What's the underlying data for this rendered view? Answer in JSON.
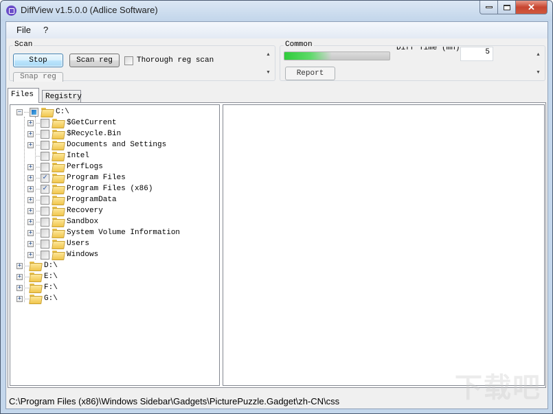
{
  "window": {
    "title": "DiffView v1.5.0.0 (Adlice Software)",
    "controls": {
      "minimize": "minimize",
      "maximize": "maximize",
      "close": "✕"
    }
  },
  "menu": {
    "items": [
      {
        "label": "File"
      },
      {
        "label": "?"
      }
    ]
  },
  "scan": {
    "group_label": "Scan",
    "stop_label": "Stop",
    "scan_reg_label": "Scan reg",
    "thorough_label": "Thorough reg scan",
    "thorough_checked": false,
    "snap_reg_label": "Snap reg"
  },
  "common": {
    "group_label": "Common",
    "progress_percent": 45,
    "diff_time_label": "Diff Time (mn)",
    "diff_time_value": "5",
    "report_label": "Report"
  },
  "tabs": [
    {
      "label": "Files",
      "active": true
    },
    {
      "label": "Registry",
      "active": false
    }
  ],
  "tree": {
    "root": {
      "label": "C:\\",
      "state": "partial",
      "expanded": true
    },
    "children": [
      {
        "label": "$GetCurrent",
        "checked": false,
        "expandable": true
      },
      {
        "label": "$Recycle.Bin",
        "checked": false,
        "expandable": true
      },
      {
        "label": "Documents and Settings",
        "checked": false,
        "expandable": true
      },
      {
        "label": "Intel",
        "checked": false,
        "expandable": false
      },
      {
        "label": "PerfLogs",
        "checked": false,
        "expandable": true
      },
      {
        "label": "Program Files",
        "checked": true,
        "expandable": true
      },
      {
        "label": "Program Files (x86)",
        "checked": true,
        "expandable": true
      },
      {
        "label": "ProgramData",
        "checked": false,
        "expandable": true
      },
      {
        "label": "Recovery",
        "checked": false,
        "expandable": true
      },
      {
        "label": "Sandbox",
        "checked": false,
        "expandable": true
      },
      {
        "label": "System Volume Information",
        "checked": false,
        "expandable": true
      },
      {
        "label": "Users",
        "checked": false,
        "expandable": true
      },
      {
        "label": "Windows",
        "checked": false,
        "expandable": true
      }
    ],
    "drives": [
      {
        "label": "D:\\"
      },
      {
        "label": "E:\\"
      },
      {
        "label": "F:\\"
      },
      {
        "label": "G:\\"
      }
    ]
  },
  "status": {
    "path": "C:\\Program Files (x86)\\Windows Sidebar\\Gadgets\\PicturePuzzle.Gadget\\zh-CN\\css"
  },
  "watermark": "下载吧"
}
